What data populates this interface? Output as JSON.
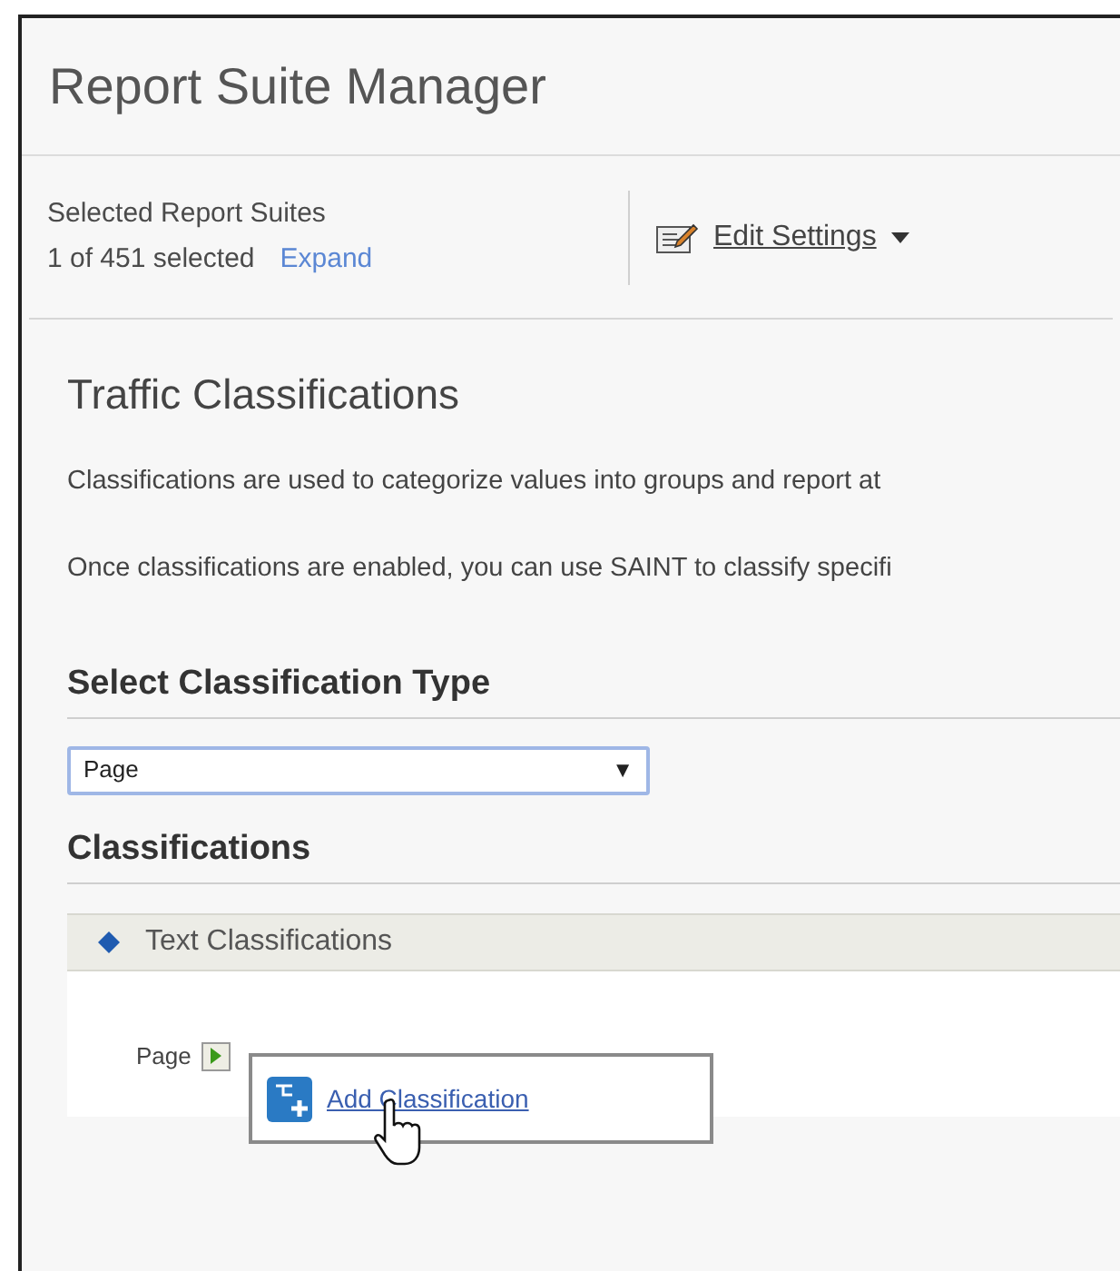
{
  "window": {
    "title": "Report Suite Manager"
  },
  "selection": {
    "heading": "Selected Report Suites",
    "count": "1 of 451 selected",
    "expand_link": "Expand"
  },
  "toolbar": {
    "edit_settings": "Edit Settings"
  },
  "section": {
    "title": "Traffic Classifications",
    "paragraphs": [
      "Classifications are used to categorize values into groups and report at",
      "Once classifications are enabled, you can use SAINT to classify specifi"
    ]
  },
  "type_select": {
    "heading": "Select Classification Type",
    "value": "Page",
    "arrow": "▼"
  },
  "classifications": {
    "heading": "Classifications",
    "group": "Text Classifications",
    "item_label": "Page",
    "menu": {
      "items": [
        "Add Classification"
      ]
    }
  }
}
